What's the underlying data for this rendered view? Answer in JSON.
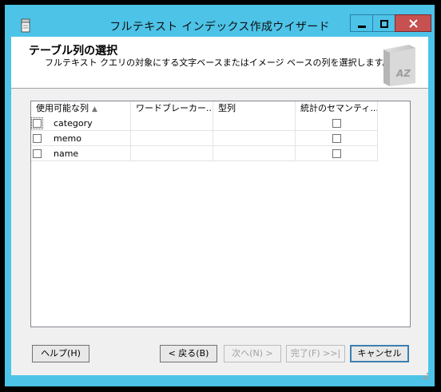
{
  "window": {
    "title": "フルテキスト インデックス作成ウイザード",
    "controls": {
      "minimize": "minimize",
      "maximize": "maximize",
      "close": "close"
    }
  },
  "banner": {
    "title": "テーブル列の選択",
    "subtitle": "フルテキスト クエリの対象にする文字ベースまたはイメージ ベースの列を選択します。",
    "art_label": "AZ"
  },
  "grid": {
    "columns": [
      {
        "label": "使用可能な列",
        "sort": "▲"
      },
      {
        "label": "ワードブレーカー..."
      },
      {
        "label": "型列"
      },
      {
        "label": "統計のセマンティ..."
      }
    ],
    "rows": [
      {
        "name": "category",
        "selected": false,
        "semantic": false
      },
      {
        "name": "memo",
        "selected": false,
        "semantic": false
      },
      {
        "name": "name",
        "selected": false,
        "semantic": false
      }
    ]
  },
  "buttons": {
    "help": "ヘルプ(H)",
    "back": "< 戻る(B)",
    "next": "次へ(N) >",
    "finish": "完了(F) >>|",
    "cancel": "キャンセル"
  }
}
